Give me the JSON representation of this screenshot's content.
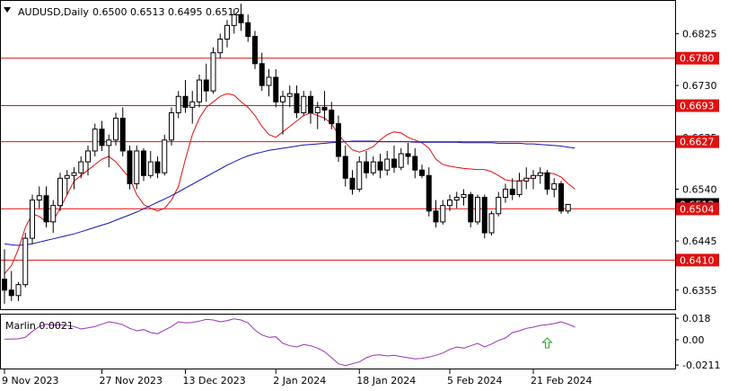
{
  "chart_data": {
    "type": "candlestick",
    "symbol_label": "AUDUSD,Daily",
    "ohlc_label": "0.6500 0.6513 0.6495 0.6512",
    "indicator_label": "Marlin 0.0021",
    "price_axis": {
      "range": [
        0.632,
        0.6885
      ],
      "ticks": [
        {
          "value": 0.6825,
          "label": "0.6825"
        },
        {
          "value": 0.673,
          "label": "0.6730"
        },
        {
          "value": 0.6635,
          "label": "0.6635"
        },
        {
          "value": 0.654,
          "label": "0.6540"
        },
        {
          "value": 0.6445,
          "label": "0.6445"
        },
        {
          "value": 0.6355,
          "label": "0.6355"
        }
      ]
    },
    "indicator_axis": {
      "range": [
        -0.024,
        0.021
      ],
      "ticks": [
        {
          "value": 0.018,
          "label": "0.018"
        },
        {
          "value": 0.0,
          "label": "0.00"
        },
        {
          "value": -0.0211,
          "label": "-0.0211"
        }
      ]
    },
    "date_labels": [
      {
        "index": 0,
        "label": "9 Nov 2023"
      },
      {
        "index": 14,
        "label": "27 Nov 2023"
      },
      {
        "index": 26,
        "label": "13 Dec 2023"
      },
      {
        "index": 39,
        "label": "2 Jan 2024"
      },
      {
        "index": 51,
        "label": "18 Jan 2024"
      },
      {
        "index": 64,
        "label": "5 Feb 2024"
      },
      {
        "index": 76,
        "label": "21 Feb 2024"
      }
    ],
    "horizontal_levels": [
      {
        "value": 0.678,
        "label": "0.6780",
        "color": "#e01010"
      },
      {
        "value": 0.6693,
        "label": "0.6693",
        "color": "#e01010"
      },
      {
        "value": 0.6627,
        "label": "0.6627",
        "color": "#e01010"
      },
      {
        "value": 0.6504,
        "label": "0.6504",
        "color": "#e01010"
      },
      {
        "value": 0.641,
        "label": "0.6410",
        "color": "#e01010"
      }
    ],
    "current_price": {
      "value": 0.6512,
      "label": "0.6512"
    },
    "candles": [
      [
        0.6375,
        0.643,
        0.633,
        0.6355
      ],
      [
        0.6355,
        0.639,
        0.6335,
        0.6345
      ],
      [
        0.6345,
        0.637,
        0.6335,
        0.6365
      ],
      [
        0.6365,
        0.646,
        0.636,
        0.645
      ],
      [
        0.645,
        0.653,
        0.644,
        0.652
      ],
      [
        0.652,
        0.6545,
        0.6505,
        0.6528
      ],
      [
        0.6528,
        0.6545,
        0.647,
        0.648
      ],
      [
        0.648,
        0.652,
        0.646,
        0.651
      ],
      [
        0.651,
        0.657,
        0.65,
        0.656
      ],
      [
        0.656,
        0.6575,
        0.653,
        0.6565
      ],
      [
        0.6565,
        0.658,
        0.654,
        0.657
      ],
      [
        0.657,
        0.66,
        0.656,
        0.659
      ],
      [
        0.659,
        0.662,
        0.6565,
        0.661
      ],
      [
        0.661,
        0.666,
        0.66,
        0.665
      ],
      [
        0.665,
        0.6665,
        0.661,
        0.662
      ],
      [
        0.662,
        0.664,
        0.658,
        0.663
      ],
      [
        0.663,
        0.668,
        0.662,
        0.667
      ],
      [
        0.667,
        0.669,
        0.66,
        0.661
      ],
      [
        0.661,
        0.662,
        0.654,
        0.655
      ],
      [
        0.655,
        0.662,
        0.654,
        0.661
      ],
      [
        0.661,
        0.6615,
        0.6555,
        0.6565
      ],
      [
        0.6565,
        0.661,
        0.656,
        0.659
      ],
      [
        0.659,
        0.66,
        0.656,
        0.657
      ],
      [
        0.657,
        0.664,
        0.6565,
        0.663
      ],
      [
        0.663,
        0.669,
        0.662,
        0.668
      ],
      [
        0.668,
        0.672,
        0.667,
        0.671
      ],
      [
        0.671,
        0.674,
        0.668,
        0.669
      ],
      [
        0.669,
        0.672,
        0.666,
        0.67
      ],
      [
        0.67,
        0.675,
        0.669,
        0.674
      ],
      [
        0.674,
        0.677,
        0.67,
        0.672
      ],
      [
        0.672,
        0.68,
        0.6715,
        0.679
      ],
      [
        0.679,
        0.6825,
        0.678,
        0.6815
      ],
      [
        0.6815,
        0.685,
        0.68,
        0.684
      ],
      [
        0.684,
        0.687,
        0.6825,
        0.686
      ],
      [
        0.686,
        0.688,
        0.683,
        0.6845
      ],
      [
        0.6845,
        0.686,
        0.681,
        0.682
      ],
      [
        0.682,
        0.683,
        0.676,
        0.677
      ],
      [
        0.677,
        0.679,
        0.672,
        0.673
      ],
      [
        0.673,
        0.676,
        0.671,
        0.6745
      ],
      [
        0.6745,
        0.676,
        0.669,
        0.67
      ],
      [
        0.67,
        0.672,
        0.664,
        0.671
      ],
      [
        0.671,
        0.673,
        0.669,
        0.6715
      ],
      [
        0.6715,
        0.673,
        0.667,
        0.668
      ],
      [
        0.668,
        0.672,
        0.6675,
        0.671
      ],
      [
        0.671,
        0.672,
        0.666,
        0.668
      ],
      [
        0.668,
        0.67,
        0.665,
        0.669
      ],
      [
        0.669,
        0.672,
        0.6665,
        0.6685
      ],
      [
        0.6685,
        0.67,
        0.665,
        0.666
      ],
      [
        0.666,
        0.6675,
        0.659,
        0.66
      ],
      [
        0.66,
        0.662,
        0.6545,
        0.656
      ],
      [
        0.656,
        0.6575,
        0.653,
        0.654
      ],
      [
        0.654,
        0.66,
        0.6535,
        0.659
      ],
      [
        0.659,
        0.661,
        0.656,
        0.657
      ],
      [
        0.657,
        0.66,
        0.6565,
        0.659
      ],
      [
        0.659,
        0.6605,
        0.656,
        0.6575
      ],
      [
        0.6575,
        0.661,
        0.6565,
        0.6595
      ],
      [
        0.6595,
        0.662,
        0.657,
        0.658
      ],
      [
        0.658,
        0.6615,
        0.6575,
        0.6605
      ],
      [
        0.6605,
        0.6625,
        0.6585,
        0.66
      ],
      [
        0.66,
        0.6615,
        0.656,
        0.6575
      ],
      [
        0.6575,
        0.6585,
        0.656,
        0.6565
      ],
      [
        0.6565,
        0.658,
        0.649,
        0.65
      ],
      [
        0.65,
        0.652,
        0.647,
        0.648
      ],
      [
        0.648,
        0.652,
        0.6475,
        0.651
      ],
      [
        0.651,
        0.653,
        0.65,
        0.652
      ],
      [
        0.652,
        0.6535,
        0.6505,
        0.6525
      ],
      [
        0.6525,
        0.654,
        0.651,
        0.653
      ],
      [
        0.653,
        0.6535,
        0.647,
        0.648
      ],
      [
        0.648,
        0.653,
        0.6475,
        0.6525
      ],
      [
        0.6525,
        0.653,
        0.645,
        0.646
      ],
      [
        0.646,
        0.65,
        0.6455,
        0.6495
      ],
      [
        0.6495,
        0.6535,
        0.649,
        0.6525
      ],
      [
        0.6525,
        0.655,
        0.6515,
        0.654
      ],
      [
        0.654,
        0.656,
        0.652,
        0.653
      ],
      [
        0.653,
        0.657,
        0.6525,
        0.6555
      ],
      [
        0.6555,
        0.658,
        0.654,
        0.656
      ],
      [
        0.656,
        0.6575,
        0.654,
        0.6565
      ],
      [
        0.6565,
        0.658,
        0.655,
        0.657
      ],
      [
        0.657,
        0.6575,
        0.653,
        0.654
      ],
      [
        0.654,
        0.656,
        0.6525,
        0.655
      ],
      [
        0.655,
        0.6555,
        0.6495,
        0.65
      ],
      [
        0.65,
        0.6513,
        0.6495,
        0.6512
      ]
    ],
    "series": [
      {
        "name": "",
        "color": "#e01010",
        "values": [
          0.6385,
          0.64,
          0.643,
          0.647,
          0.6495,
          0.649,
          0.648,
          0.6482,
          0.6505,
          0.653,
          0.6555,
          0.6565,
          0.6575,
          0.6585,
          0.6595,
          0.66,
          0.659,
          0.6575,
          0.656,
          0.653,
          0.6512,
          0.6505,
          0.65,
          0.6505,
          0.652,
          0.6545,
          0.6595,
          0.664,
          0.667,
          0.669,
          0.67,
          0.671,
          0.6715,
          0.6712,
          0.67,
          0.669,
          0.6675,
          0.6655,
          0.664,
          0.6635,
          0.6645,
          0.6655,
          0.6665,
          0.6675,
          0.668,
          0.6675,
          0.667,
          0.666,
          0.664,
          0.6625,
          0.6612,
          0.6608,
          0.6612,
          0.6618,
          0.663,
          0.664,
          0.6645,
          0.6643,
          0.6635,
          0.663,
          0.6625,
          0.6615,
          0.6595,
          0.6585,
          0.6582,
          0.658,
          0.6578,
          0.6577,
          0.6576,
          0.6576,
          0.6572,
          0.6565,
          0.6557,
          0.6555,
          0.6555,
          0.6558,
          0.6562,
          0.6568,
          0.657,
          0.6568,
          0.6562,
          0.655,
          0.654
        ]
      },
      {
        "name": "",
        "color": "#1414b4",
        "values": [
          0.644,
          0.6438,
          0.6437,
          0.6438,
          0.644,
          0.6443,
          0.6446,
          0.6449,
          0.6452,
          0.6455,
          0.6458,
          0.6462,
          0.6466,
          0.647,
          0.6474,
          0.6478,
          0.6483,
          0.6488,
          0.6493,
          0.6498,
          0.6504,
          0.651,
          0.6516,
          0.6522,
          0.6528,
          0.6535,
          0.6542,
          0.6549,
          0.6556,
          0.6563,
          0.657,
          0.6577,
          0.6584,
          0.659,
          0.6596,
          0.6601,
          0.6605,
          0.6608,
          0.6611,
          0.6613,
          0.6615,
          0.6617,
          0.6619,
          0.6621,
          0.6622,
          0.6623,
          0.6624,
          0.6625,
          0.6626,
          0.6627,
          0.6628,
          0.6628,
          0.6628,
          0.6628,
          0.6627,
          0.6627,
          0.6627,
          0.6627,
          0.6627,
          0.6626,
          0.6626,
          0.6626,
          0.6626,
          0.6626,
          0.6626,
          0.6626,
          0.6625,
          0.6625,
          0.6625,
          0.6625,
          0.6625,
          0.6624,
          0.6624,
          0.6624,
          0.6624,
          0.6623,
          0.6623,
          0.6622,
          0.6621,
          0.662,
          0.6619,
          0.6617,
          0.6615
        ]
      },
      {
        "name": "Marlin",
        "color": "#9b30b8",
        "values": [
          0.0005,
          0.0005,
          0.0008,
          0.002,
          0.007,
          0.011,
          0.013,
          0.012,
          0.0125,
          0.012,
          0.011,
          0.009,
          0.01,
          0.011,
          0.013,
          0.015,
          0.014,
          0.0125,
          0.0095,
          0.0075,
          0.0085,
          0.006,
          0.005,
          0.008,
          0.011,
          0.015,
          0.014,
          0.0145,
          0.0155,
          0.017,
          0.0165,
          0.015,
          0.016,
          0.0175,
          0.0165,
          0.014,
          0.008,
          0.004,
          0.002,
          0.0025,
          -0.003,
          -0.005,
          -0.006,
          -0.004,
          -0.005,
          -0.007,
          -0.01,
          -0.015,
          -0.02,
          -0.0215,
          -0.02,
          -0.0185,
          -0.015,
          -0.013,
          -0.0125,
          -0.0135,
          -0.013,
          -0.014,
          -0.015,
          -0.016,
          -0.0155,
          -0.0145,
          -0.013,
          -0.011,
          -0.008,
          -0.006,
          -0.007,
          -0.005,
          -0.003,
          -0.006,
          -0.0035,
          -0.0005,
          0.0015,
          0.006,
          0.0075,
          0.0095,
          0.0105,
          0.012,
          0.0125,
          0.0135,
          0.015,
          0.013,
          0.0105
        ]
      }
    ],
    "signal_arrow": {
      "index": 78,
      "value": -0.003,
      "color": "#22aa22"
    }
  },
  "colors": {
    "background": "#ffffff",
    "frame": "#000000",
    "level_line": "#e01010",
    "level_label_bg": "#e01010",
    "level_label_text": "#ffffff",
    "candle_bull_fill": "#ffffff",
    "candle_bear_fill": "#000000"
  }
}
